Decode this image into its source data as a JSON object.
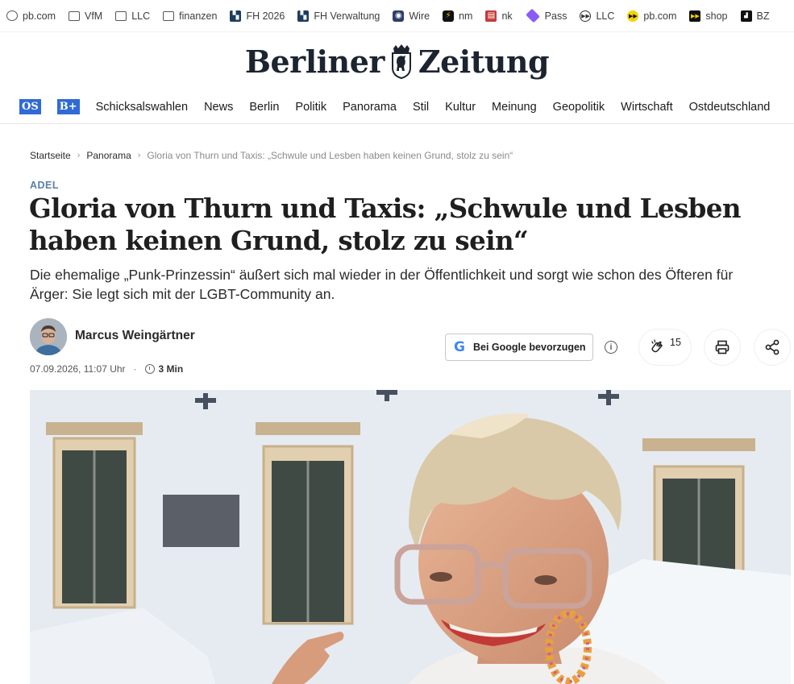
{
  "bookmarks": [
    {
      "label": "pb.com",
      "icon": "globe-icon"
    },
    {
      "label": "VfM",
      "icon": "folder-icon"
    },
    {
      "label": "LLC",
      "icon": "folder-icon"
    },
    {
      "label": "finanzen",
      "icon": "folder-icon"
    },
    {
      "label": "FH 2026",
      "icon": "fh-icon"
    },
    {
      "label": "FH Verwaltung",
      "icon": "fh-icon"
    },
    {
      "label": "Wire",
      "icon": "wire-icon"
    },
    {
      "label": "nm",
      "icon": "nm-icon"
    },
    {
      "label": "nk",
      "icon": "nk-icon"
    },
    {
      "label": "Pass",
      "icon": "pass-icon"
    },
    {
      "label": "LLC",
      "icon": "llc-icon"
    },
    {
      "label": "pb.com",
      "icon": "fast-forward-icon"
    },
    {
      "label": "shop",
      "icon": "shop-icon"
    },
    {
      "label": "BZ",
      "icon": "bz-icon"
    }
  ],
  "logo": {
    "text_left": "Berliner",
    "text_right": "Zeitung"
  },
  "nav": {
    "badge_os": "OS",
    "badge_bplus": "B+",
    "items": [
      "Schicksalswahlen",
      "News",
      "Berlin",
      "Politik",
      "Panorama",
      "Stil",
      "Kultur",
      "Meinung",
      "Geopolitik",
      "Wirtschaft",
      "Ostdeutschland"
    ]
  },
  "breadcrumb": {
    "home": "Startseite",
    "section": "Panorama",
    "current": "Gloria von Thurn und Taxis: „Schwule und Lesben haben keinen Grund, stolz zu sein“"
  },
  "article": {
    "kicker": "ADEL",
    "headline": "Gloria von Thurn und Taxis: „Schwule und Lesben haben keinen Grund, stolz zu sein“",
    "lead": "Die ehemalige „Punk-Prinzessin“ äußert sich mal wieder in der Öffentlichkeit und sorgt wie schon des Öfteren für Ärger: Sie legt sich mit der LGBT-Community an.",
    "author": "Marcus Weingärtner",
    "date": "07.09.2026, 11:07 Uhr",
    "read_time": "3 Min"
  },
  "actions": {
    "google_label": "Bei Google bevorzugen",
    "google_glyph": "G",
    "info_glyph": "i",
    "clap_count": "15"
  },
  "colors": {
    "accent_blue": "#2f6ad6",
    "kicker": "#5a7fa8"
  }
}
